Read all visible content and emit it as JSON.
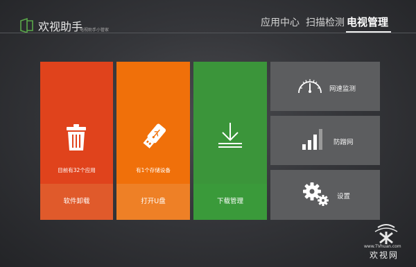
{
  "header": {
    "app_name": "欢视助手",
    "app_subtitle": "电视助手小管家",
    "nav": [
      {
        "label": "应用中心",
        "active": false
      },
      {
        "label": "扫描检测",
        "active": false
      },
      {
        "label": "电视管理",
        "active": true
      }
    ]
  },
  "tiles": {
    "uninstall": {
      "caption": "目前有32个应用",
      "action": "软件卸载",
      "color": "#e0431c",
      "icon": "trash-icon"
    },
    "usb": {
      "caption": "有1个存储设备",
      "action": "打开U盘",
      "color": "#f0700a",
      "icon": "usb-drive-icon"
    },
    "download": {
      "action": "下载管理",
      "color": "#3b953a",
      "icon": "download-icon"
    }
  },
  "side_tiles": {
    "speed": {
      "label": "网速监测",
      "icon": "speedometer-icon"
    },
    "antirub": {
      "label": "防蹭网",
      "icon": "signal-bars-icon"
    },
    "settings": {
      "label": "设置",
      "icon": "gear-icon"
    }
  },
  "watermark": {
    "url": "www.TVhuan.com",
    "name": "欢视网"
  }
}
